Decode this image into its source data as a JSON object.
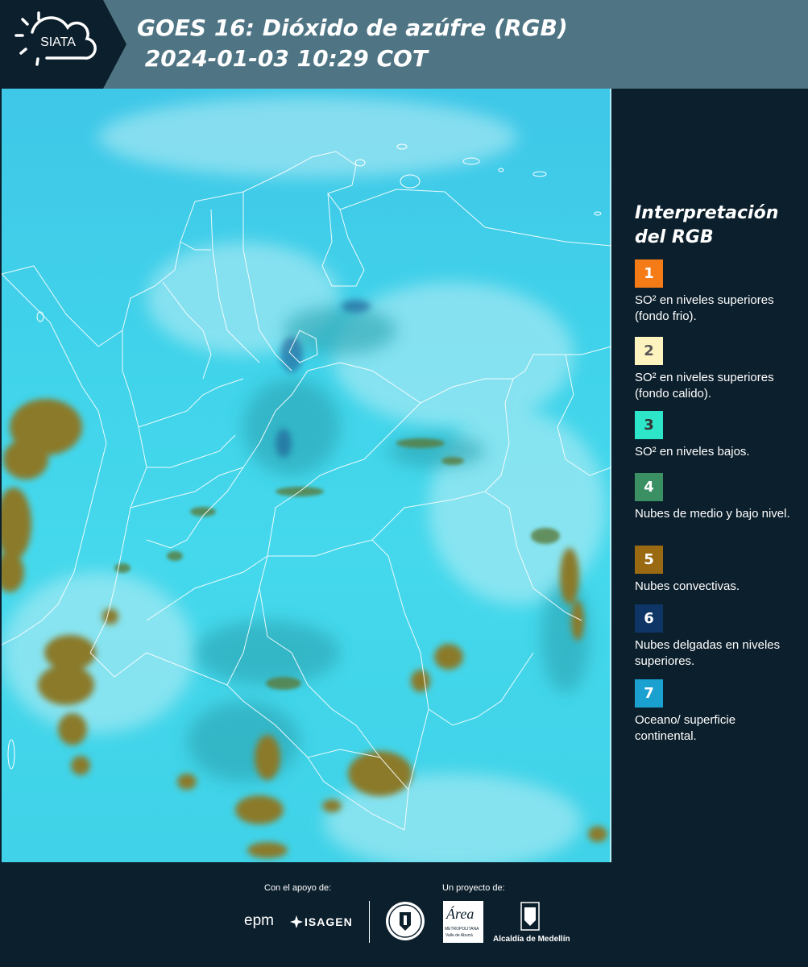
{
  "header": {
    "logo_text": "SIATA",
    "title": "GOES 16: Dióxido de azúfre (RGB)\n 2024-01-03 10:29 COT"
  },
  "legend": {
    "title": "Interpretación del RGB",
    "items": [
      {
        "number": "1",
        "color": "#f47b16",
        "text_color": "#ffffff",
        "label": "SO² en niveles superiores (fondo frio)."
      },
      {
        "number": "2",
        "color": "#fdf3bf",
        "text_color": "#555555",
        "label": "SO² en niveles superiores (fondo calido)."
      },
      {
        "number": "3",
        "color": "#2de6c9",
        "text_color": "#333333",
        "label": "SO² en niveles bajos."
      },
      {
        "number": "4",
        "color": "#3a8f63",
        "text_color": "#ffffff",
        "label": "Nubes de medio y bajo nivel."
      },
      {
        "number": "5",
        "color": "#9a6a12",
        "text_color": "#ffffff",
        "label": "Nubes convectivas."
      },
      {
        "number": "6",
        "color": "#0f3566",
        "text_color": "#ffffff",
        "label": "Nubes delgadas en niveles superiores."
      },
      {
        "number": "7",
        "color": "#1aa1cf",
        "text_color": "#ffffff",
        "label": "Oceano/ superficie continental."
      }
    ]
  },
  "footer": {
    "support_label": "Con el apoyo de:",
    "project_label": "Un proyecto de:",
    "epm": "epm",
    "isagen": "ISAGEN",
    "area_logo_text": "Área",
    "area_sub": "METROPOLITANA",
    "area_sub2": "Valle de Aburrá",
    "alcaldia": "Alcaldía de Medellín"
  },
  "colors": {
    "header_bg": "#4f7584",
    "panel_bg": "#0c1f2c",
    "map_base": "#40d3ea",
    "convective": "#8a7a2a"
  }
}
